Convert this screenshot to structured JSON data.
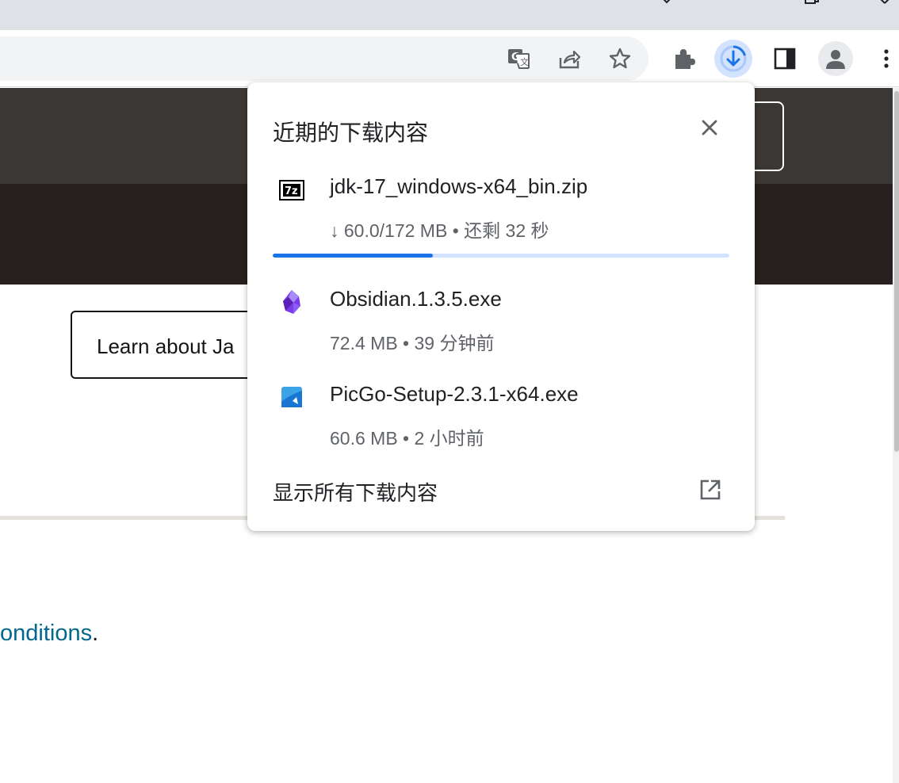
{
  "colors": {
    "accent": "#1a73e8",
    "download_button_bg": "#d3e3fd",
    "hero_dark": "#3b3734",
    "hero_darker": "#26211e",
    "link": "#00688c"
  },
  "toolbar": {
    "icons": [
      "translate-icon",
      "share-icon",
      "bookmark-star-icon",
      "extensions-icon",
      "download-icon",
      "side-panel-icon",
      "profile-icon",
      "more-menu-icon"
    ]
  },
  "page": {
    "learn_button_label": "Learn about Ja",
    "conditions_link": "onditions",
    "conditions_period": "."
  },
  "downloads": {
    "title": "近期的下载内容",
    "items": [
      {
        "icon": "7zip-icon",
        "name": "jdk-17_windows-x64_bin.zip",
        "status": "↓ 60.0/172 MB • 还剩 32 秒",
        "progress_percent": 35
      },
      {
        "icon": "obsidian-icon",
        "name": "Obsidian.1.3.5.exe",
        "status": "72.4 MB • 39 分钟前"
      },
      {
        "icon": "picgo-icon",
        "name": "PicGo-Setup-2.3.1-x64.exe",
        "status": "60.6 MB • 2 小时前"
      }
    ],
    "show_all_label": "显示所有下载内容"
  }
}
